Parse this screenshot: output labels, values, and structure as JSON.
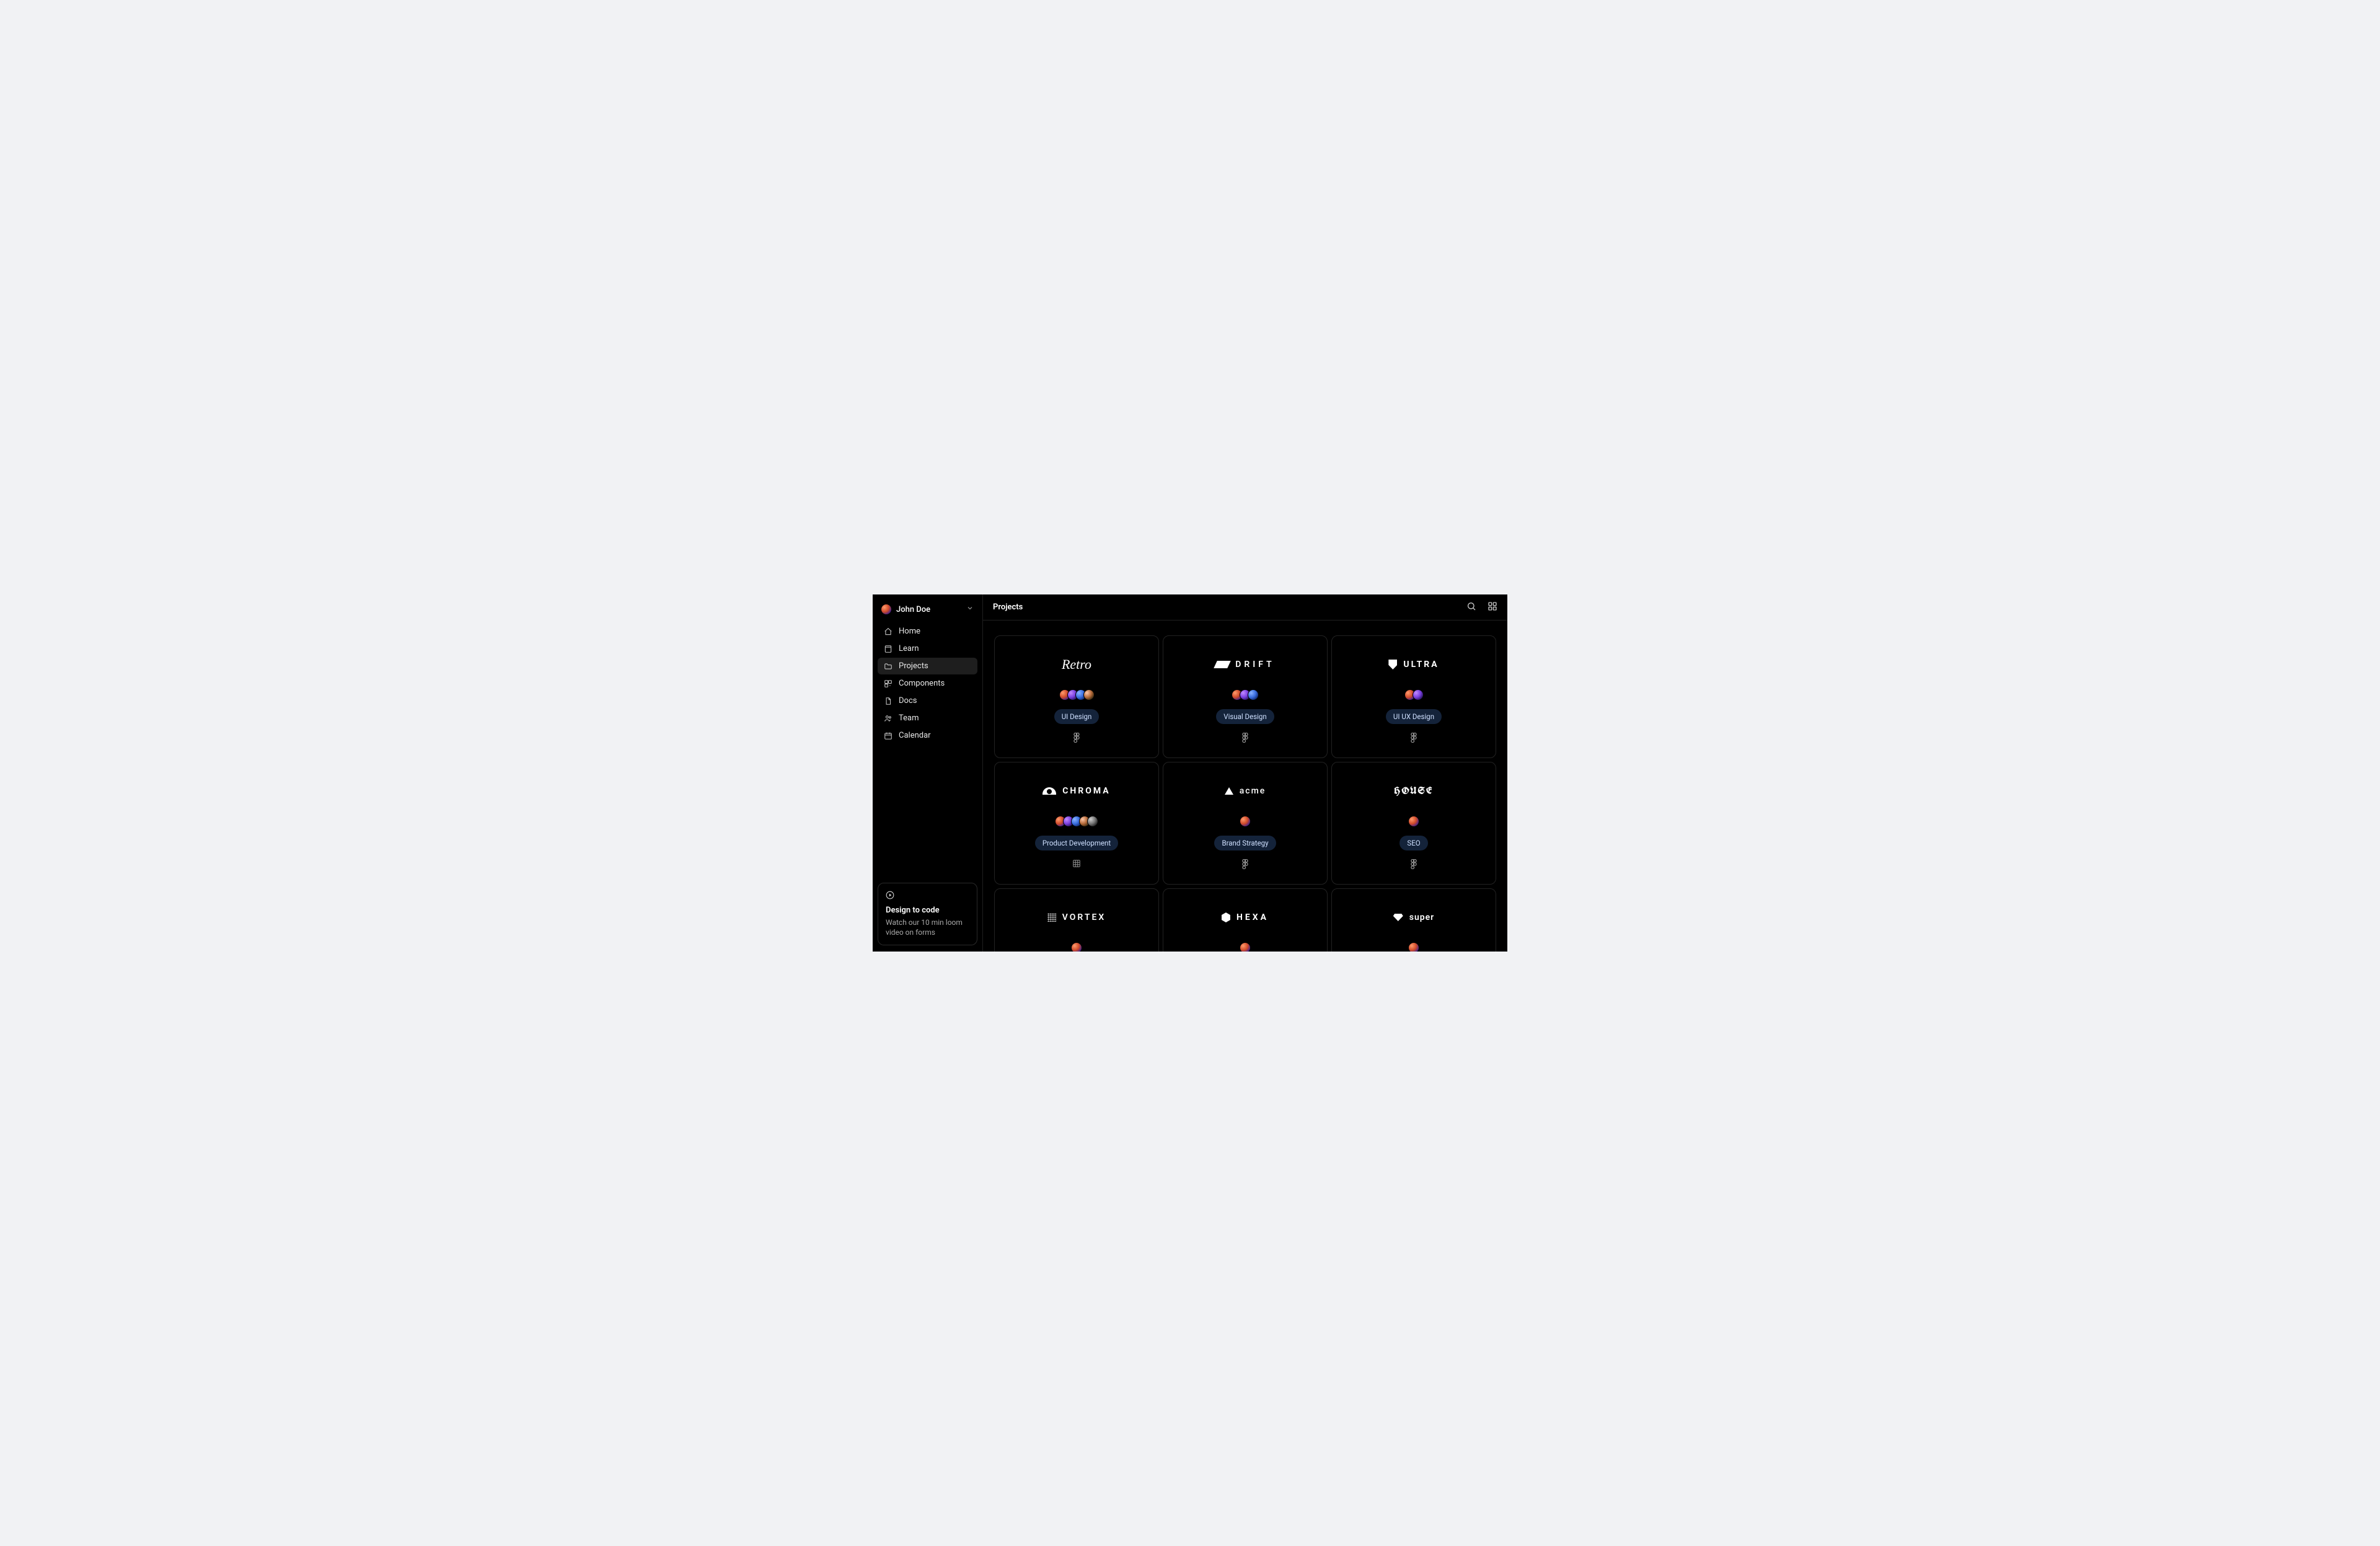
{
  "user": {
    "name": "John Doe"
  },
  "sidebar": {
    "items": [
      {
        "icon": "home",
        "label": "Home",
        "active": false
      },
      {
        "icon": "book",
        "label": "Learn",
        "active": false
      },
      {
        "icon": "folder",
        "label": "Projects",
        "active": true
      },
      {
        "icon": "components",
        "label": "Components",
        "active": false
      },
      {
        "icon": "doc",
        "label": "Docs",
        "active": false
      },
      {
        "icon": "team",
        "label": "Team",
        "active": false
      },
      {
        "icon": "calendar",
        "label": "Calendar",
        "active": false
      }
    ]
  },
  "promo": {
    "title": "Design to code",
    "description": "Watch our 10 min loom video on forms"
  },
  "header": {
    "title": "Projects"
  },
  "projects": [
    {
      "id": "retro",
      "name": "Retro",
      "logoStyle": "retro",
      "logoShape": null,
      "tag": "UI Design",
      "tool": "figma",
      "members": 4
    },
    {
      "id": "drift",
      "name": "DRIFT",
      "logoStyle": "drift",
      "logoShape": "parallelogram",
      "tag": "Visual Design",
      "tool": "figma",
      "members": 3
    },
    {
      "id": "ultra",
      "name": "ULTRA",
      "logoStyle": "ultra",
      "logoShape": "shield",
      "tag": "UI UX Design",
      "tool": "figma",
      "members": 2
    },
    {
      "id": "chroma",
      "name": "CHROMA",
      "logoStyle": "chroma",
      "logoShape": "arc",
      "tag": "Product Development",
      "tool": "sheet",
      "members": 5
    },
    {
      "id": "acme",
      "name": "acme",
      "logoStyle": "acme",
      "logoShape": "triangle",
      "tag": "Brand Strategy",
      "tool": "figma",
      "members": 1
    },
    {
      "id": "house",
      "name": "HOUSE",
      "logoStyle": "house",
      "logoShape": null,
      "tag": "SEO",
      "tool": "figma",
      "members": 1
    },
    {
      "id": "vortex",
      "name": "VORTEX",
      "logoStyle": "vortex",
      "logoShape": "dots",
      "tag": "",
      "tool": "",
      "members": 1
    },
    {
      "id": "hexa",
      "name": "HEXA",
      "logoStyle": "hexa",
      "logoShape": "hex",
      "tag": "",
      "tool": "",
      "members": 1
    },
    {
      "id": "super",
      "name": "super",
      "logoStyle": "super",
      "logoShape": "diamond",
      "tag": "",
      "tool": "",
      "members": 1
    }
  ]
}
